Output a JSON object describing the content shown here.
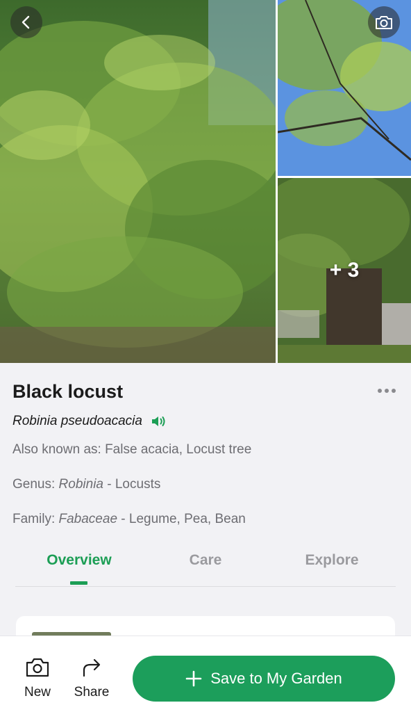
{
  "plant": {
    "common_name": "Black locust",
    "scientific_name": "Robinia pseudoacacia",
    "also_known_label": "Also known as: ",
    "also_known_value": "False acacia, Locust tree",
    "genus_label": "Genus: ",
    "genus_name": "Robinia",
    "genus_desc": " - Locusts",
    "family_label": "Family: ",
    "family_name": "Fabaceae",
    "family_desc": " - Legume, Pea, Bean"
  },
  "gallery": {
    "more_count": "+ 3"
  },
  "tabs": [
    {
      "label": "Overview",
      "active": true
    },
    {
      "label": "Care",
      "active": false
    },
    {
      "label": "Explore",
      "active": false
    }
  ],
  "bottom_bar": {
    "new_label": "New",
    "share_label": "Share",
    "save_label": "Save to My Garden"
  },
  "colors": {
    "accent": "#1c9e5b",
    "tab_active": "#1c9e55",
    "text_secondary": "#6d6d72"
  },
  "icons": {
    "back": "chevron-left-icon",
    "camera": "camera-icon",
    "more": "more-horizontal-icon",
    "pronounce": "speaker-icon",
    "share": "share-arrow-icon",
    "add": "plus-icon"
  }
}
